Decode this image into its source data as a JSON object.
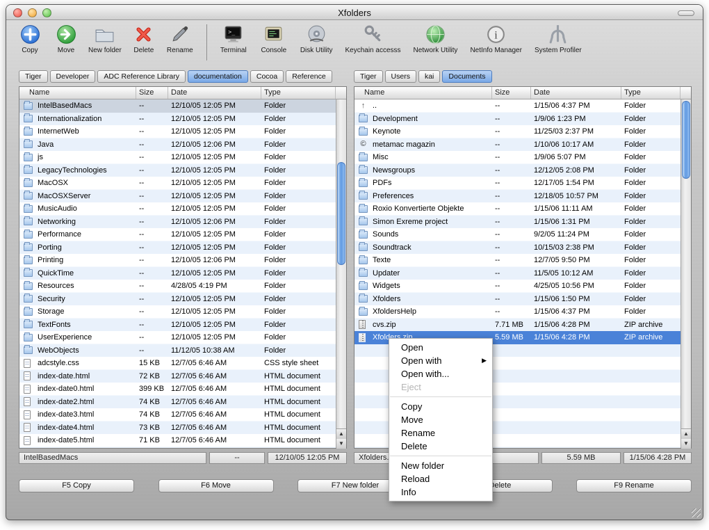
{
  "window": {
    "title": "Xfolders"
  },
  "colors": {
    "selection": "#4a82d8",
    "stripe": "#e9f1fb",
    "path_selected": "#79a8e7"
  },
  "toolbar": {
    "file_actions": [
      {
        "label": "Copy",
        "icon": "copy"
      },
      {
        "label": "Move",
        "icon": "move"
      },
      {
        "label": "New folder",
        "icon": "new-folder"
      },
      {
        "label": "Delete",
        "icon": "delete"
      },
      {
        "label": "Rename",
        "icon": "rename"
      }
    ],
    "apps": [
      {
        "label": "Terminal",
        "icon": "terminal"
      },
      {
        "label": "Console",
        "icon": "console"
      },
      {
        "label": "Disk Utility",
        "icon": "disk-utility"
      },
      {
        "label": "Keychain accesss",
        "icon": "keychain"
      },
      {
        "label": "Network Utility",
        "icon": "network"
      },
      {
        "label": "NetInfo Manager",
        "icon": "netinfo"
      },
      {
        "label": "System Profiler",
        "icon": "system-profiler"
      }
    ]
  },
  "paths": {
    "left": {
      "items": [
        "Tiger",
        "Developer",
        "ADC Reference Library",
        "documentation",
        "Cocoa",
        "Reference"
      ],
      "selected_index": 3
    },
    "right": {
      "items": [
        "Tiger",
        "Users",
        "kai",
        "Documents"
      ],
      "selected_index": 3
    }
  },
  "left_pane": {
    "columns": [
      "Name",
      "Size",
      "Date",
      "Type"
    ],
    "rows": [
      {
        "icon": "folder",
        "name": "IntelBasedMacs",
        "size": "--",
        "date": "12/10/05 12:05 PM",
        "type": "Folder",
        "selected": "inactive"
      },
      {
        "icon": "folder",
        "name": "Internationalization",
        "size": "--",
        "date": "12/10/05 12:05 PM",
        "type": "Folder"
      },
      {
        "icon": "folder",
        "name": "InternetWeb",
        "size": "--",
        "date": "12/10/05 12:05 PM",
        "type": "Folder"
      },
      {
        "icon": "folder",
        "name": "Java",
        "size": "--",
        "date": "12/10/05 12:06 PM",
        "type": "Folder"
      },
      {
        "icon": "folder",
        "name": "js",
        "size": "--",
        "date": "12/10/05 12:05 PM",
        "type": "Folder"
      },
      {
        "icon": "folder",
        "name": "LegacyTechnologies",
        "size": "--",
        "date": "12/10/05 12:05 PM",
        "type": "Folder"
      },
      {
        "icon": "folder",
        "name": "MacOSX",
        "size": "--",
        "date": "12/10/05 12:05 PM",
        "type": "Folder"
      },
      {
        "icon": "folder",
        "name": "MacOSXServer",
        "size": "--",
        "date": "12/10/05 12:05 PM",
        "type": "Folder"
      },
      {
        "icon": "folder",
        "name": "MusicAudio",
        "size": "--",
        "date": "12/10/05 12:05 PM",
        "type": "Folder"
      },
      {
        "icon": "folder",
        "name": "Networking",
        "size": "--",
        "date": "12/10/05 12:06 PM",
        "type": "Folder"
      },
      {
        "icon": "folder",
        "name": "Performance",
        "size": "--",
        "date": "12/10/05 12:05 PM",
        "type": "Folder"
      },
      {
        "icon": "folder",
        "name": "Porting",
        "size": "--",
        "date": "12/10/05 12:05 PM",
        "type": "Folder"
      },
      {
        "icon": "folder",
        "name": "Printing",
        "size": "--",
        "date": "12/10/05 12:06 PM",
        "type": "Folder"
      },
      {
        "icon": "folder",
        "name": "QuickTime",
        "size": "--",
        "date": "12/10/05 12:05 PM",
        "type": "Folder"
      },
      {
        "icon": "folder",
        "name": "Resources",
        "size": "--",
        "date": "4/28/05 4:19 PM",
        "type": "Folder"
      },
      {
        "icon": "folder",
        "name": "Security",
        "size": "--",
        "date": "12/10/05 12:05 PM",
        "type": "Folder"
      },
      {
        "icon": "folder",
        "name": "Storage",
        "size": "--",
        "date": "12/10/05 12:05 PM",
        "type": "Folder"
      },
      {
        "icon": "folder",
        "name": "TextFonts",
        "size": "--",
        "date": "12/10/05 12:05 PM",
        "type": "Folder"
      },
      {
        "icon": "folder",
        "name": "UserExperience",
        "size": "--",
        "date": "12/10/05 12:05 PM",
        "type": "Folder"
      },
      {
        "icon": "folder",
        "name": "WebObjects",
        "size": "--",
        "date": "11/12/05 10:38 AM",
        "type": "Folder"
      },
      {
        "icon": "file",
        "name": "adcstyle.css",
        "size": "15 KB",
        "date": "12/7/05 6:46 AM",
        "type": "CSS style sheet"
      },
      {
        "icon": "file",
        "name": "index-date.html",
        "size": "72 KB",
        "date": "12/7/05 6:46 AM",
        "type": "HTML document"
      },
      {
        "icon": "file",
        "name": "index-date0.html",
        "size": "399 KB",
        "date": "12/7/05 6:46 AM",
        "type": "HTML document"
      },
      {
        "icon": "file",
        "name": "index-date2.html",
        "size": "74 KB",
        "date": "12/7/05 6:46 AM",
        "type": "HTML document"
      },
      {
        "icon": "file",
        "name": "index-date3.html",
        "size": "74 KB",
        "date": "12/7/05 6:46 AM",
        "type": "HTML document"
      },
      {
        "icon": "file",
        "name": "index-date4.html",
        "size": "73 KB",
        "date": "12/7/05 6:46 AM",
        "type": "HTML document"
      },
      {
        "icon": "file",
        "name": "index-date5.html",
        "size": "71 KB",
        "date": "12/7/05 6:46 AM",
        "type": "HTML document"
      }
    ],
    "status": {
      "name": "IntelBasedMacs",
      "size": "--",
      "date": "12/10/05 12:05 PM"
    }
  },
  "right_pane": {
    "columns": [
      "Name",
      "Size",
      "Date",
      "Type"
    ],
    "rows": [
      {
        "icon": "up",
        "name": "..",
        "size": "--",
        "date": "1/15/06 4:37 PM",
        "type": "Folder"
      },
      {
        "icon": "folder",
        "name": "Development",
        "size": "--",
        "date": "1/9/06 1:23 PM",
        "type": "Folder"
      },
      {
        "icon": "folder",
        "name": "Keynote",
        "size": "--",
        "date": "11/25/03 2:37 PM",
        "type": "Folder"
      },
      {
        "icon": "copyright",
        "name": "metamac magazin",
        "size": "--",
        "date": "1/10/06 10:17 AM",
        "type": "Folder"
      },
      {
        "icon": "folder",
        "name": "Misc",
        "size": "--",
        "date": "1/9/06 5:07 PM",
        "type": "Folder"
      },
      {
        "icon": "folder",
        "name": "Newsgroups",
        "size": "--",
        "date": "12/12/05 2:08 PM",
        "type": "Folder"
      },
      {
        "icon": "folder",
        "name": "PDFs",
        "size": "--",
        "date": "12/17/05 1:54 PM",
        "type": "Folder"
      },
      {
        "icon": "folder",
        "name": "Preferences",
        "size": "--",
        "date": "12/18/05 10:57 PM",
        "type": "Folder"
      },
      {
        "icon": "folder",
        "name": "Roxio Konvertierte Objekte",
        "size": "--",
        "date": "1/15/06 11:11 AM",
        "type": "Folder"
      },
      {
        "icon": "folder",
        "name": "Simon Exreme project",
        "size": "--",
        "date": "1/15/06 1:31 PM",
        "type": "Folder"
      },
      {
        "icon": "folder",
        "name": "Sounds",
        "size": "--",
        "date": "9/2/05 11:24 PM",
        "type": "Folder"
      },
      {
        "icon": "folder",
        "name": "Soundtrack",
        "size": "--",
        "date": "10/15/03 2:38 PM",
        "type": "Folder"
      },
      {
        "icon": "folder",
        "name": "Texte",
        "size": "--",
        "date": "12/7/05 9:50 PM",
        "type": "Folder"
      },
      {
        "icon": "folder",
        "name": "Updater",
        "size": "--",
        "date": "11/5/05 10:12 AM",
        "type": "Folder"
      },
      {
        "icon": "folder",
        "name": "Widgets",
        "size": "--",
        "date": "4/25/05 10:56 PM",
        "type": "Folder"
      },
      {
        "icon": "folder",
        "name": "Xfolders",
        "size": "--",
        "date": "1/15/06 1:50 PM",
        "type": "Folder"
      },
      {
        "icon": "folder",
        "name": "XfoldersHelp",
        "size": "--",
        "date": "1/15/06 4:37 PM",
        "type": "Folder"
      },
      {
        "icon": "zip",
        "name": "cvs.zip",
        "size": "7.71 MB",
        "date": "1/15/06 4:28 PM",
        "type": "ZIP archive"
      },
      {
        "icon": "zip",
        "name": "Xfolders.zip",
        "size": "5.59 MB",
        "date": "1/15/06 4:28 PM",
        "type": "ZIP archive",
        "selected": "active"
      }
    ],
    "status": {
      "name": "Xfolders.zip",
      "size": "5.59 MB",
      "date": "1/15/06 4:28 PM"
    }
  },
  "context_menu": {
    "items": [
      {
        "label": "Open"
      },
      {
        "label": "Open with",
        "submenu": true
      },
      {
        "label": "Open with..."
      },
      {
        "label": "Eject",
        "disabled": true
      },
      {
        "type": "separator"
      },
      {
        "label": "Copy"
      },
      {
        "label": "Move"
      },
      {
        "label": "Rename"
      },
      {
        "label": "Delete"
      },
      {
        "type": "separator"
      },
      {
        "label": "New folder"
      },
      {
        "label": "Reload"
      },
      {
        "label": "Info"
      }
    ]
  },
  "function_bar": {
    "buttons": [
      "F5 Copy",
      "F6 Move",
      "F7 New folder",
      "F8 Delete",
      "F9 Rename"
    ]
  }
}
